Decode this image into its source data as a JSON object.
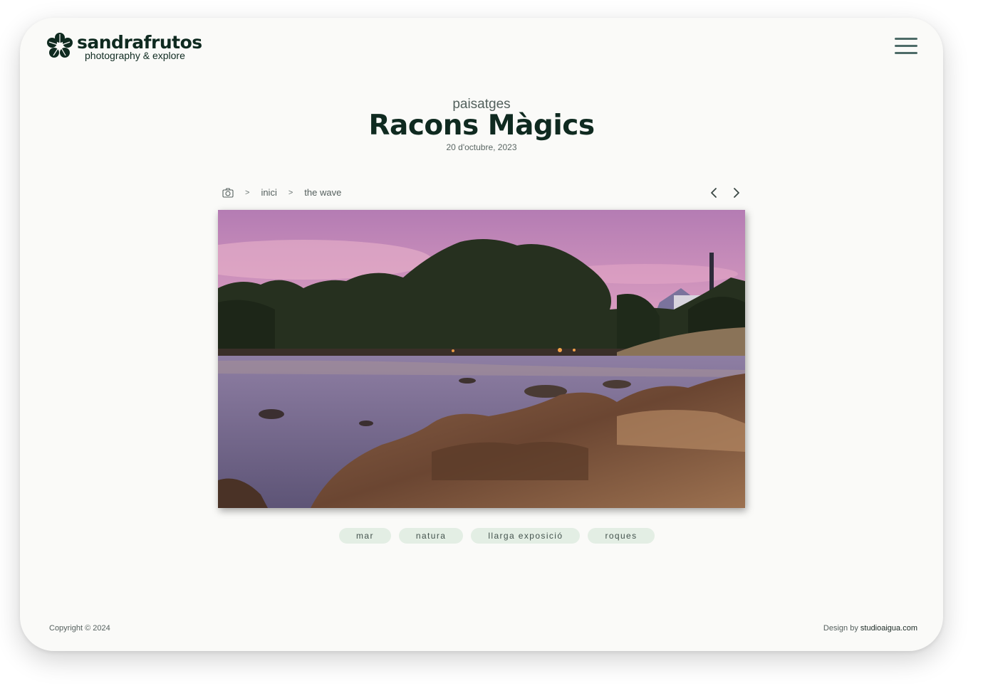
{
  "header": {
    "brand": "sandrafrutos",
    "tagline": "photography & explore",
    "logo_icon": "clover-flower-icon",
    "menu_icon": "hamburger-menu-icon"
  },
  "post": {
    "category": "paisatges",
    "title": "Racons Màgics",
    "date": "20 d'octubre, 2023"
  },
  "breadcrumb": {
    "icon": "camera-icon",
    "items": [
      "inici",
      "the wave"
    ],
    "separator": ">"
  },
  "navigation": {
    "prev_icon": "chevron-left-icon",
    "next_icon": "chevron-right-icon"
  },
  "tags": [
    "mar",
    "natura",
    "llarga exposició",
    "roques"
  ],
  "footer": {
    "copyright": "Copyright © 2024",
    "design_prefix": "Design by",
    "design_link": "studioaigua.com"
  },
  "colors": {
    "brand_dark": "#0f2a20",
    "menu": "#4d6b68",
    "tag_bg": "#e3eee4",
    "page_bg": "#fafaf8"
  }
}
